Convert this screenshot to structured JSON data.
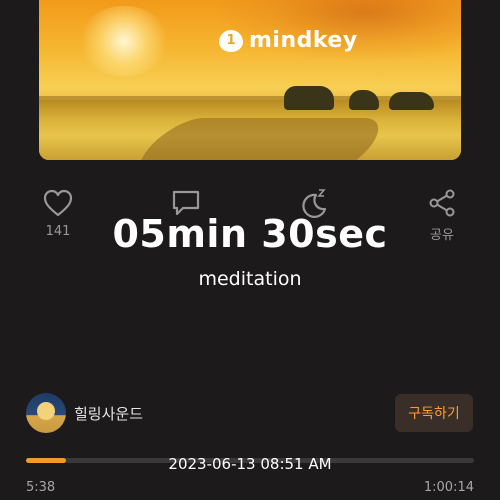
{
  "cover": {
    "brand": "mindkey"
  },
  "actions": [
    {
      "icon": "heart-icon",
      "label": "141"
    },
    {
      "icon": "comment-icon",
      "label": ""
    },
    {
      "icon": "sleep-moon-icon",
      "label": ""
    },
    {
      "icon": "share-icon",
      "label": "공유"
    }
  ],
  "overlay": {
    "duration": "05min 30sec",
    "category": "meditation",
    "date": "2023-06-13 08:51 AM"
  },
  "channel": {
    "name": "힐링사운드",
    "subscribe_label": "구독하기"
  },
  "player": {
    "elapsed": "5:38",
    "total": "1:00:14",
    "progress": 0.09
  },
  "colors": {
    "accent": "#f39a24",
    "background": "#1c1a1b"
  }
}
